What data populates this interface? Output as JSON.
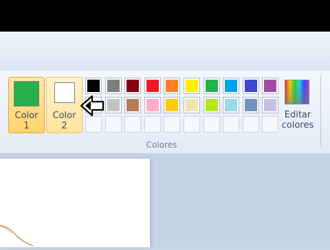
{
  "colors_group": {
    "group_label": "Colores",
    "color1": {
      "label_line1": "Color",
      "label_line2": "1",
      "color": "#27b04b"
    },
    "color2": {
      "label_line1": "Color",
      "label_line2": "2",
      "color": "#ffffff"
    },
    "edit_colors": {
      "label_line1": "Editar",
      "label_line2": "colores",
      "icon": "rainbow-palette-icon"
    },
    "palette_row1": [
      "#000000",
      "#7f7f7f",
      "#880015",
      "#ed1c24",
      "#ff7f27",
      "#fff200",
      "#22b14c",
      "#00a2e8",
      "#3f48cc",
      "#a349a4"
    ],
    "palette_row2": [
      "#ffffff",
      "#c3c3c3",
      "#b97a57",
      "#ffaec9",
      "#ffc90e",
      "#efe4b0",
      "#b5e61d",
      "#99d9ea",
      "#7092be",
      "#c8bfe7"
    ],
    "palette_row3": [
      "",
      "",
      "",
      "",
      "",
      "",
      "",
      "",
      "",
      ""
    ]
  },
  "cursor": {
    "icon": "pointer-cursor-icon"
  }
}
